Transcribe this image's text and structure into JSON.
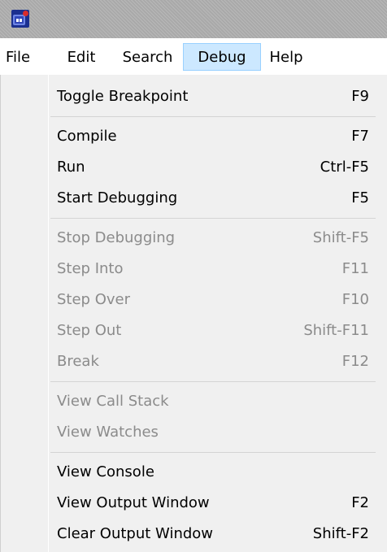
{
  "menubar": {
    "items": [
      {
        "label": "File"
      },
      {
        "label": "Edit"
      },
      {
        "label": "Search"
      },
      {
        "label": "Debug"
      },
      {
        "label": "Help"
      }
    ],
    "active": "Debug"
  },
  "debug_menu": {
    "groups": [
      [
        {
          "label": "Toggle Breakpoint",
          "shortcut": "F9",
          "enabled": true
        }
      ],
      [
        {
          "label": "Compile",
          "shortcut": "F7",
          "enabled": true
        },
        {
          "label": "Run",
          "shortcut": "Ctrl-F5",
          "enabled": true
        },
        {
          "label": "Start Debugging",
          "shortcut": "F5",
          "enabled": true
        }
      ],
      [
        {
          "label": "Stop Debugging",
          "shortcut": "Shift-F5",
          "enabled": false
        },
        {
          "label": "Step Into",
          "shortcut": "F11",
          "enabled": false
        },
        {
          "label": "Step Over",
          "shortcut": "F10",
          "enabled": false
        },
        {
          "label": "Step Out",
          "shortcut": "Shift-F11",
          "enabled": false
        },
        {
          "label": "Break",
          "shortcut": "F12",
          "enabled": false
        }
      ],
      [
        {
          "label": "View Call Stack",
          "shortcut": "",
          "enabled": false
        },
        {
          "label": "View Watches",
          "shortcut": "",
          "enabled": false
        }
      ],
      [
        {
          "label": "View Console",
          "shortcut": "",
          "enabled": true
        },
        {
          "label": "View Output Window",
          "shortcut": "F2",
          "enabled": true
        },
        {
          "label": "Clear Output Window",
          "shortcut": "Shift-F2",
          "enabled": true
        }
      ]
    ]
  },
  "colors": {
    "active_menu_bg": "#cce8ff",
    "active_menu_border": "#99d1ff",
    "disabled_text": "#8b8b8b",
    "menu_bg": "#f0f0f0"
  },
  "icons": {
    "app": "app-logo-icon"
  }
}
